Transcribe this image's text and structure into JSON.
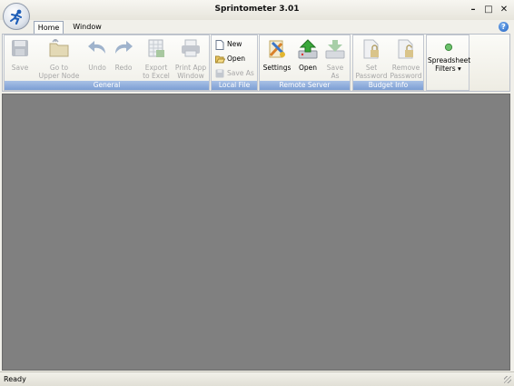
{
  "window": {
    "title": "Sprintometer 3.01"
  },
  "window_controls": {
    "minimize": "–",
    "maximize": "□",
    "close": "✕"
  },
  "tabs": [
    {
      "label": "Home",
      "active": true
    },
    {
      "label": "Window",
      "active": false
    }
  ],
  "help": {
    "label": "?"
  },
  "ribbon": {
    "general": {
      "label": "General",
      "buttons": [
        {
          "line1": "Save",
          "line2": "",
          "enabled": false,
          "icon": "floppy-disk-icon"
        },
        {
          "line1": "Go to",
          "line2": "Upper Node",
          "enabled": false,
          "icon": "folder-up-icon"
        },
        {
          "line1": "Undo",
          "line2": "",
          "enabled": false,
          "icon": "undo-arrow-icon"
        },
        {
          "line1": "Redo",
          "line2": "",
          "enabled": false,
          "icon": "redo-arrow-icon"
        },
        {
          "line1": "Export",
          "line2": "to Excel",
          "enabled": false,
          "icon": "excel-sheet-icon"
        },
        {
          "line1": "Print App",
          "line2": "Window",
          "enabled": false,
          "icon": "printer-icon"
        }
      ]
    },
    "local_file": {
      "label": "Local File",
      "buttons": [
        {
          "label": "New",
          "enabled": true,
          "icon": "new-document-icon"
        },
        {
          "label": "Open",
          "enabled": true,
          "icon": "open-folder-icon"
        },
        {
          "label": "Save As",
          "enabled": false,
          "icon": "save-as-icon"
        }
      ]
    },
    "remote_server": {
      "label": "Remote Server",
      "buttons": [
        {
          "line1": "Settings",
          "line2": "",
          "enabled": true,
          "icon": "settings-tools-icon"
        },
        {
          "line1": "Open",
          "line2": "",
          "enabled": true,
          "icon": "server-download-icon"
        },
        {
          "line1": "Save",
          "line2": "As",
          "enabled": false,
          "icon": "server-upload-icon"
        }
      ]
    },
    "budget_info": {
      "label": "Budget Info",
      "buttons": [
        {
          "line1": "Set",
          "line2": "Password",
          "enabled": false,
          "icon": "document-lock-icon"
        },
        {
          "line1": "Remove",
          "line2": "Password",
          "enabled": false,
          "icon": "document-unlock-icon"
        }
      ]
    },
    "filters": {
      "line1": "Spreadsheet",
      "line2": "Filters ▾",
      "icon": "green-dot-icon"
    }
  },
  "status": {
    "text": "Ready"
  },
  "colors": {
    "content_background": "#808080",
    "group_label": "#7c9ed3",
    "accent_blue": "#1d5fc0",
    "disabled_text": "#a7a7a7"
  }
}
